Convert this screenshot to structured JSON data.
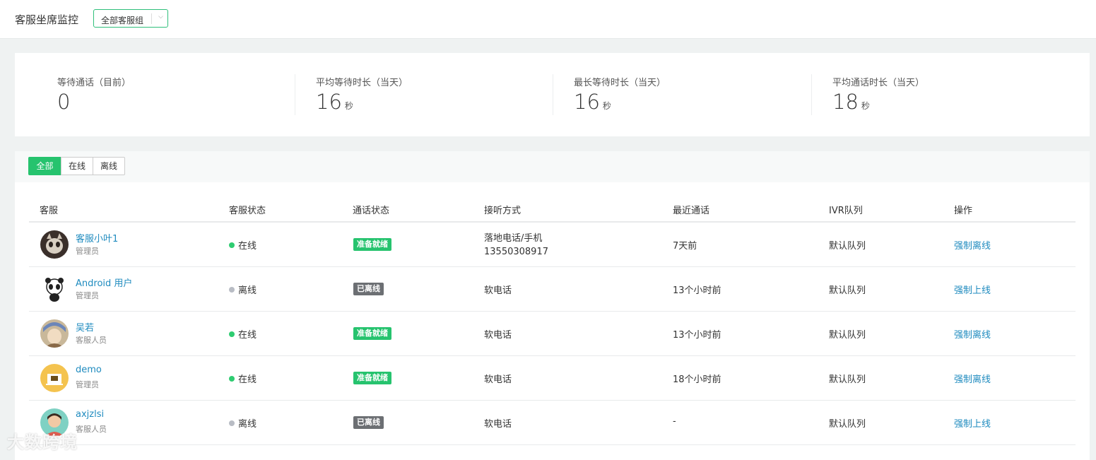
{
  "header": {
    "title": "客服坐席监控",
    "group_select": "全部客服组"
  },
  "stats": [
    {
      "label": "等待通话（目前）",
      "value": "0",
      "unit": ""
    },
    {
      "label": "平均等待时长（当天）",
      "value": "16",
      "unit": "秒"
    },
    {
      "label": "最长等待时长（当天）",
      "value": "16",
      "unit": "秒"
    },
    {
      "label": "平均通话时长（当天）",
      "value": "18",
      "unit": "秒"
    }
  ],
  "filters": {
    "all": "全部",
    "online": "在线",
    "offline": "离线"
  },
  "table": {
    "columns": [
      "客服",
      "客服状态",
      "通话状态",
      "接听方式",
      "最近通话",
      "IVR队列",
      "操作"
    ],
    "rows": [
      {
        "name": "客服小叶1",
        "role": "管理员",
        "status": "在线",
        "call_status": "准备就绪",
        "answer": "落地电话/手机",
        "phone": "13550308917",
        "recent": "7天前",
        "queue": "默认队列",
        "action": "强制离线"
      },
      {
        "name": "Android 用户",
        "role": "管理员",
        "status": "离线",
        "call_status": "已离线",
        "answer": "软电话",
        "phone": "",
        "recent": "13个小时前",
        "queue": "默认队列",
        "action": "强制上线"
      },
      {
        "name": "吴若",
        "role": "客服人员",
        "status": "在线",
        "call_status": "准备就绪",
        "answer": "软电话",
        "phone": "",
        "recent": "13个小时前",
        "queue": "默认队列",
        "action": "强制离线"
      },
      {
        "name": "demo",
        "role": "管理员",
        "status": "在线",
        "call_status": "准备就绪",
        "answer": "软电话",
        "phone": "",
        "recent": "18个小时前",
        "queue": "默认队列",
        "action": "强制离线"
      },
      {
        "name": "axjzlsi",
        "role": "客服人员",
        "status": "离线",
        "call_status": "已离线",
        "answer": "软电话",
        "phone": "",
        "recent": "-",
        "queue": "默认队列",
        "action": "强制上线"
      }
    ]
  },
  "colors": {
    "online": "#2ecc71",
    "offline": "#b8bcc4",
    "ready_badge": "#26c36e",
    "offline_badge": "#6c6f73",
    "link": "#1f8bbf"
  },
  "watermark": "大数跨境"
}
